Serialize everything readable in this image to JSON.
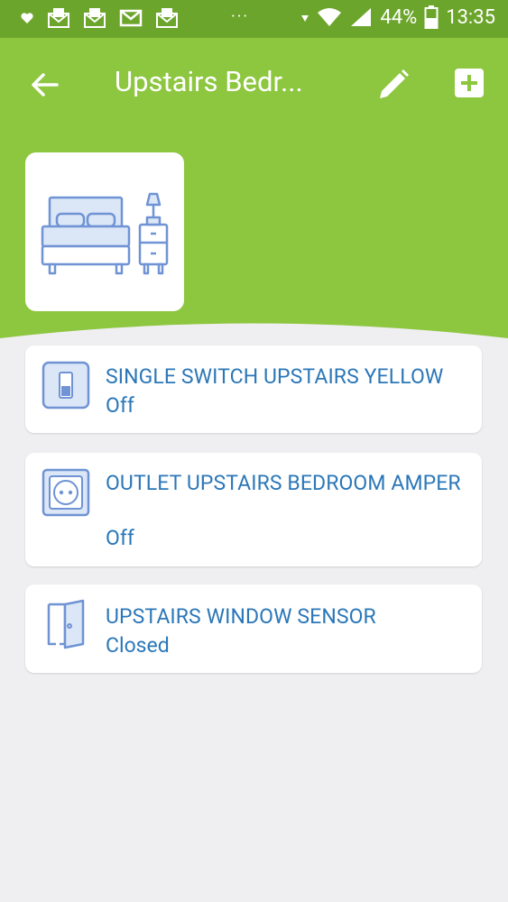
{
  "status_bar": {
    "battery": "44%",
    "time": "13:35",
    "dots": "···"
  },
  "header": {
    "title": "Upstairs Bedr...",
    "background_color": "#8dc63f",
    "status_bar_color": "#6ca52c"
  },
  "devices": [
    {
      "title": "SINGLE SWITCH UPSTAIRS YELLOW",
      "status": "Off",
      "icon": "light-switch-icon"
    },
    {
      "title": "OUTLET UPSTAIRS BEDROOM AMPER",
      "status": "Off",
      "icon": "outlet-icon"
    },
    {
      "title": "UPSTAIRS WINDOW SENSOR",
      "status": "Closed",
      "icon": "door-sensor-icon"
    }
  ],
  "accent_color": "#2b77b8",
  "icon_color": "#6f93d4"
}
